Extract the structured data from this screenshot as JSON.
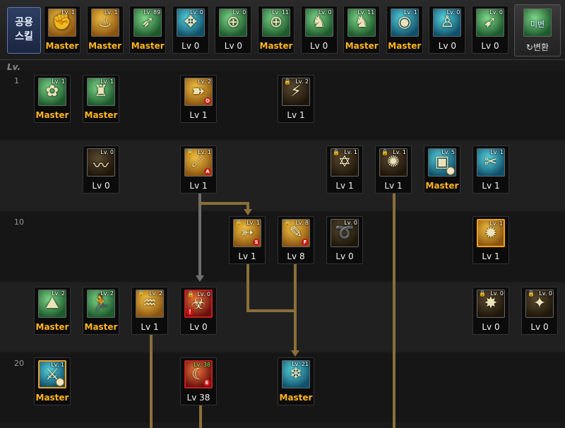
{
  "header": {
    "common_label_line1": "공용",
    "common_label_line2": "스킬",
    "lv_header": "Lv.",
    "convert_label": "변환",
    "convert_icon_text": "미변",
    "common_skills": [
      {
        "badge": "Lv. 1",
        "label": "Master",
        "color": "gold",
        "glyph": "✊"
      },
      {
        "badge": "Lv. 1",
        "label": "Master",
        "color": "gold",
        "glyph": "♨"
      },
      {
        "badge": "Lv. 89",
        "label": "Master",
        "color": "green",
        "glyph": "➶"
      },
      {
        "badge": "Lv. 0",
        "label": "Lv 0",
        "color": "teal",
        "glyph": "✥"
      },
      {
        "badge": "Lv. 0",
        "label": "Lv 0",
        "color": "green",
        "glyph": "⊕"
      },
      {
        "badge": "Lv. 11",
        "label": "Master",
        "color": "green",
        "glyph": "⊕"
      },
      {
        "badge": "Lv. 0",
        "label": "Lv 0",
        "color": "green",
        "glyph": "♞"
      },
      {
        "badge": "Lv. 11",
        "label": "Master",
        "color": "green",
        "glyph": "♞"
      },
      {
        "badge": "Lv. 1",
        "label": "Master",
        "color": "teal",
        "glyph": "◉"
      },
      {
        "badge": "Lv. 0",
        "label": "Lv 0",
        "color": "teal",
        "glyph": "♙"
      },
      {
        "badge": "Lv. 0",
        "label": "Lv 0",
        "color": "green",
        "glyph": "➹"
      }
    ]
  },
  "rows": [
    "1",
    "",
    "10",
    "",
    "20"
  ],
  "skills": [
    {
      "row": 0,
      "col": 1,
      "badge": "Lv. 1",
      "label": "Master",
      "color": "green",
      "glyph": "✿"
    },
    {
      "row": 0,
      "col": 2,
      "badge": "Lv. 1",
      "label": "Master",
      "color": "green",
      "glyph": "♜"
    },
    {
      "row": 0,
      "col": 4,
      "badge": "Lv. 2",
      "label": "Lv 1",
      "color": "gold",
      "glyph": "➽",
      "flag": "D"
    },
    {
      "row": 0,
      "col": 6,
      "badge": "Lv. 2",
      "label": "Lv 1",
      "color": "dark",
      "glyph": "⚡",
      "lock": true
    },
    {
      "row": 1,
      "col": 2,
      "badge": "Lv. 0",
      "label": "Lv 0",
      "color": "dark",
      "glyph": "〰"
    },
    {
      "row": 1,
      "col": 4,
      "badge": "Lv. 1",
      "label": "Lv 1",
      "color": "gold",
      "glyph": "☄",
      "lock": true,
      "flag": "A"
    },
    {
      "row": 1,
      "col": 7,
      "badge": "Lv. 1",
      "label": "Lv 1",
      "color": "dark",
      "glyph": "✡",
      "lock": true
    },
    {
      "row": 1,
      "col": 8,
      "badge": "Lv. 1",
      "label": "Lv 1",
      "color": "dark",
      "glyph": "✺",
      "lock": true
    },
    {
      "row": 1,
      "col": 9,
      "badge": "Lv. 5",
      "label": "Master",
      "color": "teal",
      "glyph": "▣",
      "clock": true
    },
    {
      "row": 1,
      "col": 10,
      "badge": "Lv. 1",
      "label": "Lv 1",
      "color": "teal",
      "glyph": "✂"
    },
    {
      "row": 2,
      "col": 5,
      "badge": "Lv. 1",
      "label": "Lv 1",
      "color": "gold",
      "glyph": "➳",
      "lock": true,
      "flag": "S"
    },
    {
      "row": 2,
      "col": 6,
      "badge": "Lv. 8",
      "label": "Lv 8",
      "color": "gold",
      "glyph": "✎",
      "lock": true,
      "flag": "F"
    },
    {
      "row": 2,
      "col": 7,
      "badge": "Lv. 0",
      "label": "Lv 0",
      "color": "dark",
      "glyph": "➰"
    },
    {
      "row": 2,
      "col": 10,
      "badge": "Lv. 1",
      "label": "Lv 1",
      "color": "gold",
      "glyph": "✹",
      "border": "orange"
    },
    {
      "row": 3,
      "col": 1,
      "badge": "Lv. 2",
      "label": "Master",
      "color": "green",
      "glyph": "⛰"
    },
    {
      "row": 3,
      "col": 2,
      "badge": "Lv. 2",
      "label": "Master",
      "color": "green",
      "glyph": "🏃"
    },
    {
      "row": 3,
      "col": 3,
      "badge": "Lv. 2",
      "label": "Lv 1",
      "color": "gold",
      "glyph": "♒",
      "lock": true
    },
    {
      "row": 3,
      "col": 4,
      "badge": "Lv. 0",
      "label": "Lv 0",
      "color": "red",
      "glyph": "☣",
      "lock": true,
      "warn": true,
      "border": "red"
    },
    {
      "row": 3,
      "col": 10,
      "badge": "Lv. 0",
      "label": "Lv 0",
      "color": "dark",
      "glyph": "✸",
      "lock": true
    },
    {
      "row": 3,
      "col": 11,
      "badge": "Lv. 0",
      "label": "Lv 0",
      "color": "dark",
      "glyph": "✦",
      "lock": true
    },
    {
      "row": 4,
      "col": 1,
      "badge": "Lv. 1",
      "label": "Master",
      "color": "teal",
      "glyph": "⚔",
      "clock": true,
      "border": "orange"
    },
    {
      "row": 4,
      "col": 4,
      "badge": "Lv. 38",
      "badge_green": true,
      "label": "Lv 38",
      "color": "red",
      "glyph": "☾",
      "flag": "E",
      "border": "red"
    },
    {
      "row": 4,
      "col": 6,
      "badge": "Lv. 21",
      "label": "Master",
      "color": "teal",
      "glyph": "❄"
    }
  ]
}
